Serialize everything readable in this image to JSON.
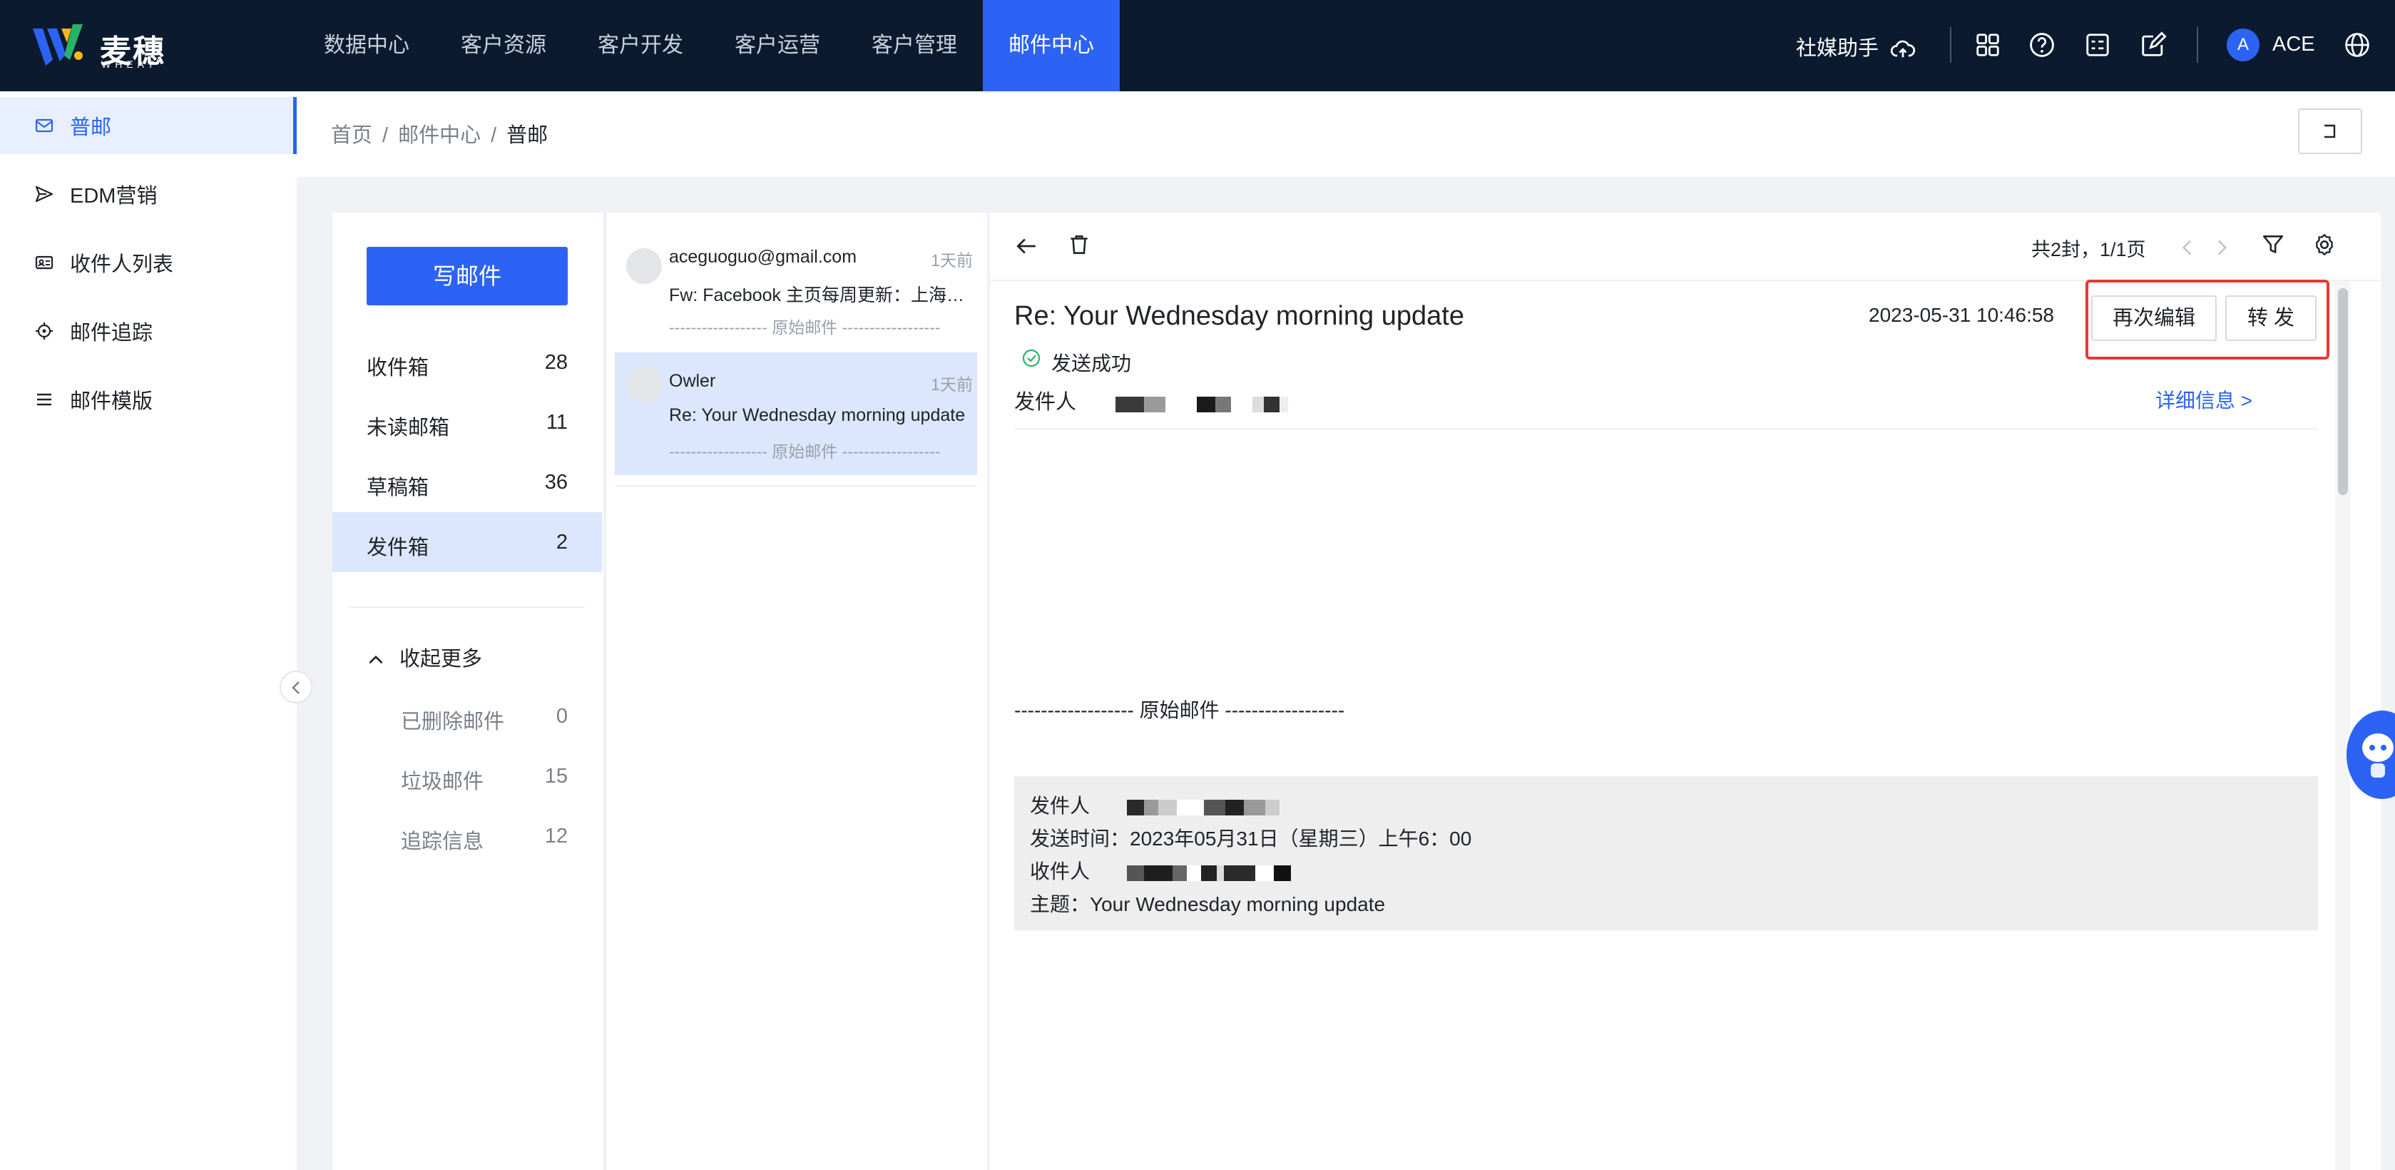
{
  "brand": {
    "name_cn": "麦穗",
    "name_en": "WHEAT"
  },
  "nav": {
    "items": [
      "数据中心",
      "客户资源",
      "客户开发",
      "客户运营",
      "客户管理",
      "邮件中心"
    ],
    "active_index": 5
  },
  "header": {
    "social_label": "社媒助手",
    "user_initial": "A",
    "user_name": "ACE"
  },
  "sidebar": {
    "items": [
      {
        "label": "普邮",
        "icon": "mail-icon"
      },
      {
        "label": "EDM营销",
        "icon": "send-icon"
      },
      {
        "label": "收件人列表",
        "icon": "contact-card-icon"
      },
      {
        "label": "邮件追踪",
        "icon": "target-icon"
      },
      {
        "label": "邮件模版",
        "icon": "list-icon"
      }
    ]
  },
  "breadcrumb": {
    "home": "首页",
    "section": "邮件中心",
    "current": "普邮"
  },
  "folders": {
    "compose_label": "写邮件",
    "items": [
      {
        "name": "收件箱",
        "count": "28"
      },
      {
        "name": "未读邮箱",
        "count": "11"
      },
      {
        "name": "草稿箱",
        "count": "36"
      },
      {
        "name": "发件箱",
        "count": "2"
      }
    ],
    "more_label": "收起更多",
    "sub_items": [
      {
        "name": "已删除邮件",
        "count": "0"
      },
      {
        "name": "垃圾邮件",
        "count": "15"
      },
      {
        "name": "追踪信息",
        "count": "12"
      }
    ]
  },
  "mail_list": [
    {
      "from": "aceguoguo@gmail.com",
      "time": "1天前",
      "subject": "Fw: Facebook 主页每周更新：上海二...",
      "preview": "------------------ 原始邮件 ------------------"
    },
    {
      "from": "Owler",
      "time": "1天前",
      "subject": "Re: Your Wednesday morning update",
      "preview": "------------------ 原始邮件 ------------------"
    }
  ],
  "detail": {
    "pager": "共2封，1/1页",
    "subject": "Re: Your Wednesday morning update",
    "datetime": "2023-05-31 10:46:58",
    "edit_again_label": "再次编辑",
    "forward_label": "转 发",
    "status": "发送成功",
    "sender_label": "发件人",
    "detail_link": "详细信息 >",
    "original_separator": "------------------ 原始邮件 ------------------",
    "original": {
      "from_label": "发件人",
      "sent_label": "发送时间：2023年05月31日（星期三）上午6：00",
      "to_label": "收件人",
      "subject_label": "主题：Your Wednesday morning update"
    }
  },
  "colors": {
    "primary": "#2c63f5",
    "topbar": "#0b1a2e",
    "highlight": "#e53935"
  }
}
